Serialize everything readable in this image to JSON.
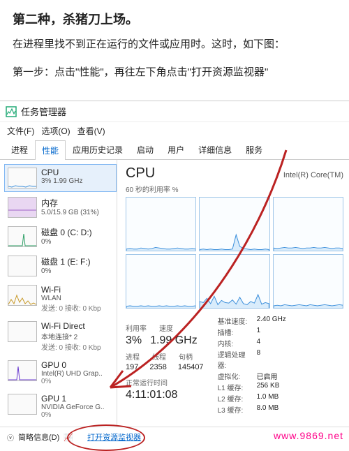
{
  "intro": {
    "heading": "第二种，杀猪刀上场。",
    "p1": "在进程里找不到正在运行的文件或应用时。这时，如下图：",
    "p2": "第一步：点击\"性能\"，再往左下角点击\"打开资源监视器\""
  },
  "taskmgr": {
    "title": "任务管理器",
    "menu": {
      "file": "文件(F)",
      "options": "选项(O)",
      "view": "查看(V)"
    },
    "tabs": {
      "processes": "进程",
      "performance": "性能",
      "apphistory": "应用历史记录",
      "startup": "启动",
      "users": "用户",
      "details": "详细信息",
      "services": "服务"
    },
    "side": {
      "cpu": {
        "name": "CPU",
        "sub": "3% 1.99 GHz"
      },
      "mem": {
        "name": "内存",
        "sub": "5.0/15.9 GB (31%)"
      },
      "disk0": {
        "name": "磁盘 0 (C: D:)",
        "sub": "0%"
      },
      "disk1": {
        "name": "磁盘 1 (E: F:)",
        "sub": "0%"
      },
      "wifi": {
        "name": "Wi-Fi",
        "sub": "WLAN",
        "sub2": "发送: 0 接收: 0 Kbp"
      },
      "wifid": {
        "name": "Wi-Fi Direct",
        "sub": "本地连接* 2",
        "sub2": "发送: 0 接收: 0 Kbp"
      },
      "gpu0": {
        "name": "GPU 0",
        "sub": "Intel(R) UHD Grap..",
        "sub2": "0%"
      },
      "gpu1": {
        "name": "GPU 1",
        "sub": "NVIDIA GeForce G..",
        "sub2": "0%"
      }
    },
    "main": {
      "title": "CPU",
      "model": "Intel(R) Core(TM)",
      "subtitle": "60 秒的利用率 %",
      "stats_labels": {
        "util": "利用率",
        "speed": "速度",
        "proc": "进程",
        "threads": "线程",
        "handles": "句柄"
      },
      "stats": {
        "util": "3%",
        "speed": "1.99 GHz",
        "proc": "197",
        "threads": "2358",
        "handles": "145407"
      },
      "uptime_label": "正常运行时间",
      "uptime": "4:11:01:08",
      "spec": {
        "base_l": "基准速度:",
        "base_v": "2.40 GHz",
        "sockets_l": "插槽:",
        "sockets_v": "1",
        "cores_l": "内核:",
        "cores_v": "4",
        "lp_l": "逻辑处理器:",
        "lp_v": "8",
        "virt_l": "虚拟化:",
        "virt_v": "已启用",
        "l1_l": "L1 缓存:",
        "l1_v": "256 KB",
        "l2_l": "L2 缓存:",
        "l2_v": "1.0 MB",
        "l3_l": "L3 缓存:",
        "l3_v": "8.0 MB"
      }
    },
    "footer": {
      "less": "简略信息(D)",
      "resmon": "打开资源监视器"
    }
  },
  "watermark": "www.9869.net",
  "chart_data": [
    {
      "type": "line",
      "title": "CPU core 0",
      "ylim": [
        0,
        100
      ],
      "x": "last 60s",
      "values": [
        3,
        4,
        3,
        3,
        5,
        4,
        3,
        4,
        6,
        5,
        4,
        3,
        3,
        4,
        5,
        4,
        3,
        3,
        4,
        3
      ]
    },
    {
      "type": "line",
      "title": "CPU core 1",
      "ylim": [
        0,
        100
      ],
      "x": "last 60s",
      "values": [
        2,
        3,
        2,
        3,
        2,
        2,
        3,
        2,
        2,
        3,
        30,
        8,
        4,
        3,
        2,
        3,
        2,
        2,
        3,
        2
      ]
    },
    {
      "type": "line",
      "title": "CPU core 2",
      "ylim": [
        0,
        100
      ],
      "x": "last 60s",
      "values": [
        5,
        4,
        5,
        6,
        5,
        5,
        6,
        5,
        4,
        5,
        5,
        6,
        5,
        5,
        6,
        5,
        4,
        5,
        5,
        4
      ]
    },
    {
      "type": "line",
      "title": "CPU core 3",
      "ylim": [
        0,
        100
      ],
      "x": "last 60s",
      "values": [
        3,
        4,
        3,
        3,
        4,
        3,
        4,
        3,
        3,
        4,
        3,
        4,
        3,
        3,
        4,
        3,
        4,
        3,
        3,
        4
      ]
    },
    {
      "type": "line",
      "title": "CPU core 4",
      "ylim": [
        0,
        100
      ],
      "x": "last 60s",
      "values": [
        12,
        10,
        18,
        8,
        22,
        6,
        14,
        10,
        9,
        15,
        7,
        20,
        8,
        6,
        12,
        9,
        25,
        7,
        10,
        8
      ]
    },
    {
      "type": "line",
      "title": "CPU core 5",
      "ylim": [
        0,
        100
      ],
      "x": "last 60s",
      "values": [
        4,
        5,
        4,
        6,
        5,
        4,
        5,
        6,
        5,
        4,
        6,
        5,
        4,
        5,
        6,
        5,
        4,
        5,
        6,
        5
      ]
    }
  ]
}
